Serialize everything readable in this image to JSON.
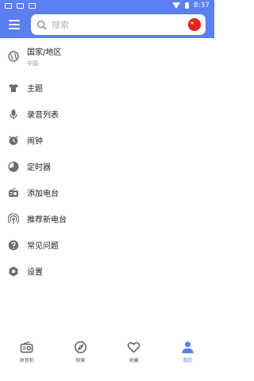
{
  "status_bar": {
    "time": "8:37"
  },
  "search": {
    "placeholder": "搜索"
  },
  "colors": {
    "accent": "#5b7ef0",
    "icon_gray": "#6e6e6e",
    "flag_red": "#e02424"
  },
  "menu": {
    "items": [
      {
        "label": "国家/地区",
        "subtitle": "中国",
        "icon": "globe-icon"
      },
      {
        "label": "主题",
        "icon": "tshirt-icon"
      },
      {
        "label": "录音列表",
        "icon": "microphone-icon"
      },
      {
        "label": "闹钟",
        "icon": "alarm-clock-icon"
      },
      {
        "label": "定时器",
        "icon": "timer-icon"
      },
      {
        "label": "添加电台",
        "icon": "add-radio-icon"
      },
      {
        "label": "推荐新电台",
        "icon": "broadcast-icon"
      },
      {
        "label": "常见问题",
        "icon": "help-icon"
      },
      {
        "label": "设置",
        "icon": "gear-icon"
      }
    ]
  },
  "bottom_nav": {
    "items": [
      {
        "label": "收音机",
        "icon": "radio-icon",
        "active": false
      },
      {
        "label": "探索",
        "icon": "compass-icon",
        "active": false
      },
      {
        "label": "收藏",
        "icon": "heart-icon",
        "active": false
      },
      {
        "label": "我的",
        "icon": "person-icon",
        "active": true
      }
    ]
  }
}
